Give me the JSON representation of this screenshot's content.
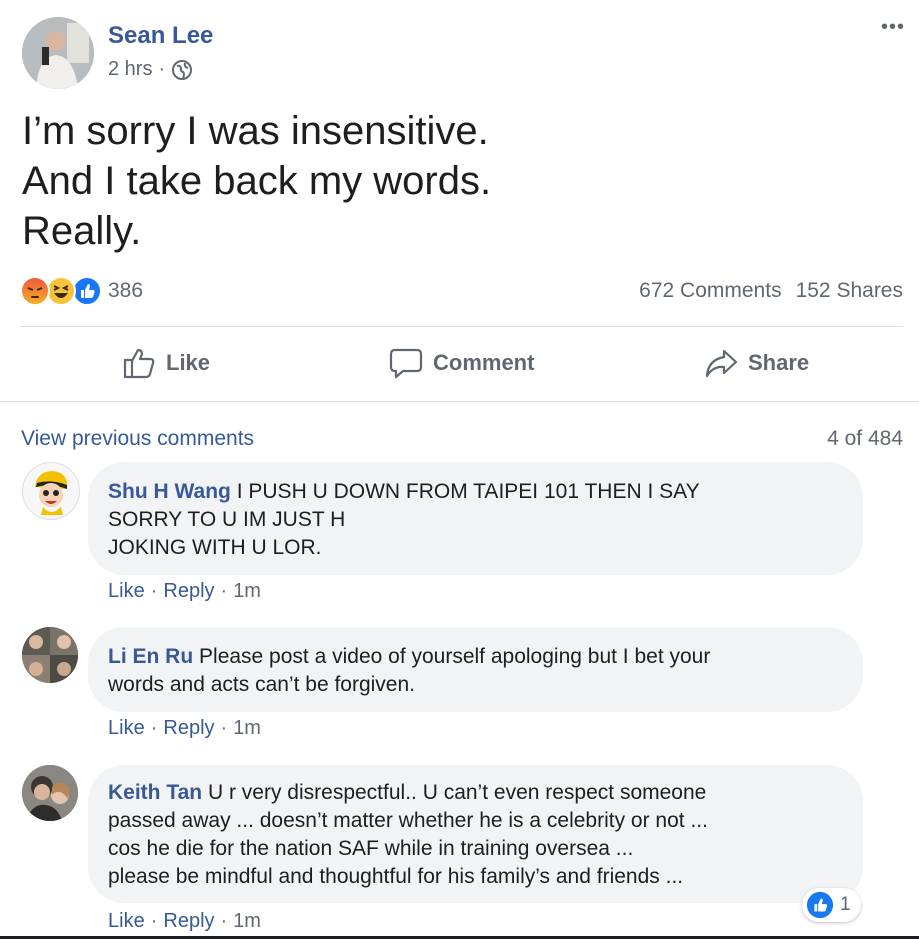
{
  "post": {
    "author": "Sean Lee",
    "time": "2 hrs",
    "separator": "·",
    "more_label": "•••",
    "lines": [
      "I’m sorry I was insensitive.",
      "And I take back my words.",
      "Really."
    ],
    "reaction_count": "386",
    "comments_count": "672 Comments",
    "shares_count": "152 Shares",
    "reactions": [
      "angry-icon",
      "haha-icon",
      "like-icon"
    ]
  },
  "actions": {
    "like": "Like",
    "comment": "Comment",
    "share": "Share"
  },
  "comments_header": {
    "view_previous": "View previous comments",
    "count": "4 of 484"
  },
  "comments": [
    {
      "name": "Shu H Wang",
      "lines": [
        "I PUSH U DOWN FROM TAIPEI 101 THEN I SAY",
        "SORRY TO U IM JUST H",
        "JOKING WITH U LOR."
      ],
      "like": "Like",
      "reply": "Reply",
      "time": "1m"
    },
    {
      "name": "Li En Ru",
      "lines": [
        "Please post a video of yourself apologing but I bet your",
        "words and acts can’t be forgiven."
      ],
      "like": "Like",
      "reply": "Reply",
      "time": "1m"
    },
    {
      "name": "Keith Tan",
      "lines": [
        "U r very disrespectful.. U can’t even respect someone",
        "passed away ... doesn’t matter whether he is a celebrity or not ...",
        "cos he die for the nation SAF while in training oversea ...",
        "please be mindful and thoughtful for his family’s and friends ..."
      ],
      "like": "Like",
      "reply": "Reply",
      "time": "1m",
      "reaction_count": "1"
    }
  ],
  "colors": {
    "link": "#385898",
    "text": "#1c1e21",
    "muted": "#606770",
    "bubble": "#f2f3f5",
    "like_blue": "#1877f2"
  }
}
